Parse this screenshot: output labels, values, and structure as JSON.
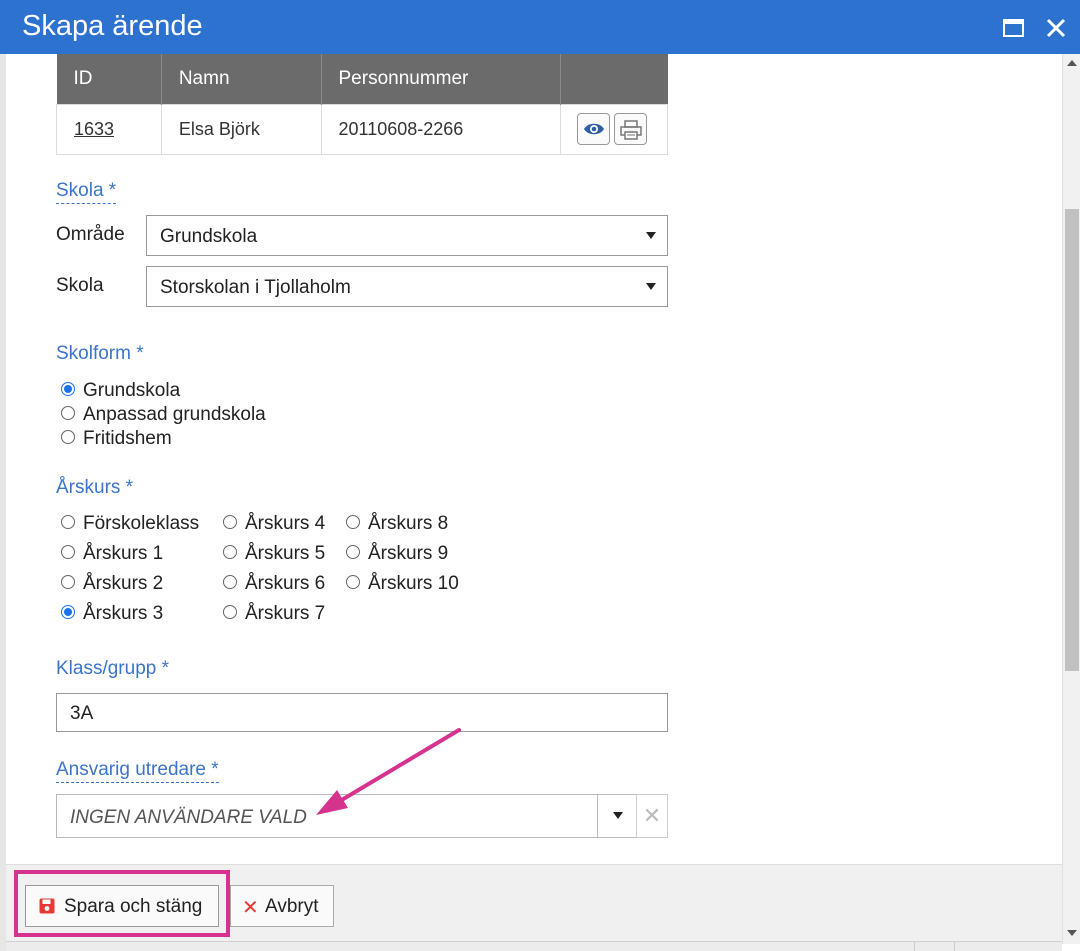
{
  "window": {
    "title": "Skapa ärende"
  },
  "student_table": {
    "headers": [
      "ID",
      "Namn",
      "Personnummer",
      ""
    ],
    "row": {
      "id": "1633",
      "name": "Elsa Björk",
      "personnummer": "20110608-2266"
    }
  },
  "skola_section": {
    "label": "Skola *",
    "omrade_label": "Område",
    "omrade_value": "Grundskola",
    "skola_label": "Skola",
    "skola_value": "Storskolan i Tjollaholm"
  },
  "skolform_section": {
    "label": "Skolform *",
    "options": [
      "Grundskola",
      "Anpassad grundskola",
      "Fritidshem"
    ],
    "selected": "Grundskola"
  },
  "arskurs_section": {
    "label": "Årskurs *",
    "options": [
      "Förskoleklass",
      "Årskurs 1",
      "Årskurs 2",
      "Årskurs 3",
      "Årskurs 4",
      "Årskurs 5",
      "Årskurs 6",
      "Årskurs 7",
      "Årskurs 8",
      "Årskurs 9",
      "Årskurs 10"
    ],
    "selected": "Årskurs 3"
  },
  "klass_section": {
    "label": "Klass/grupp *",
    "value": "3A"
  },
  "utredare_section": {
    "label": "Ansvarig utredare *",
    "value": "INGEN ANVÄNDARE VALD"
  },
  "footer": {
    "save_label": "Spara och stäng",
    "cancel_label": "Avbryt"
  },
  "colors": {
    "titlebar": "#2d72cf",
    "section_label": "#3b74c9",
    "annotation": "#d6338f",
    "radio_checked": "#1a73e8",
    "cancel_icon": "#e53935",
    "save_icon": "#e53935"
  },
  "icons": {
    "maximize": "maximize-icon",
    "close": "close-icon",
    "view": "eye-icon",
    "print": "printer-icon",
    "save": "floppy-disk-icon",
    "cancel": "x-icon",
    "clear": "clear-icon"
  }
}
